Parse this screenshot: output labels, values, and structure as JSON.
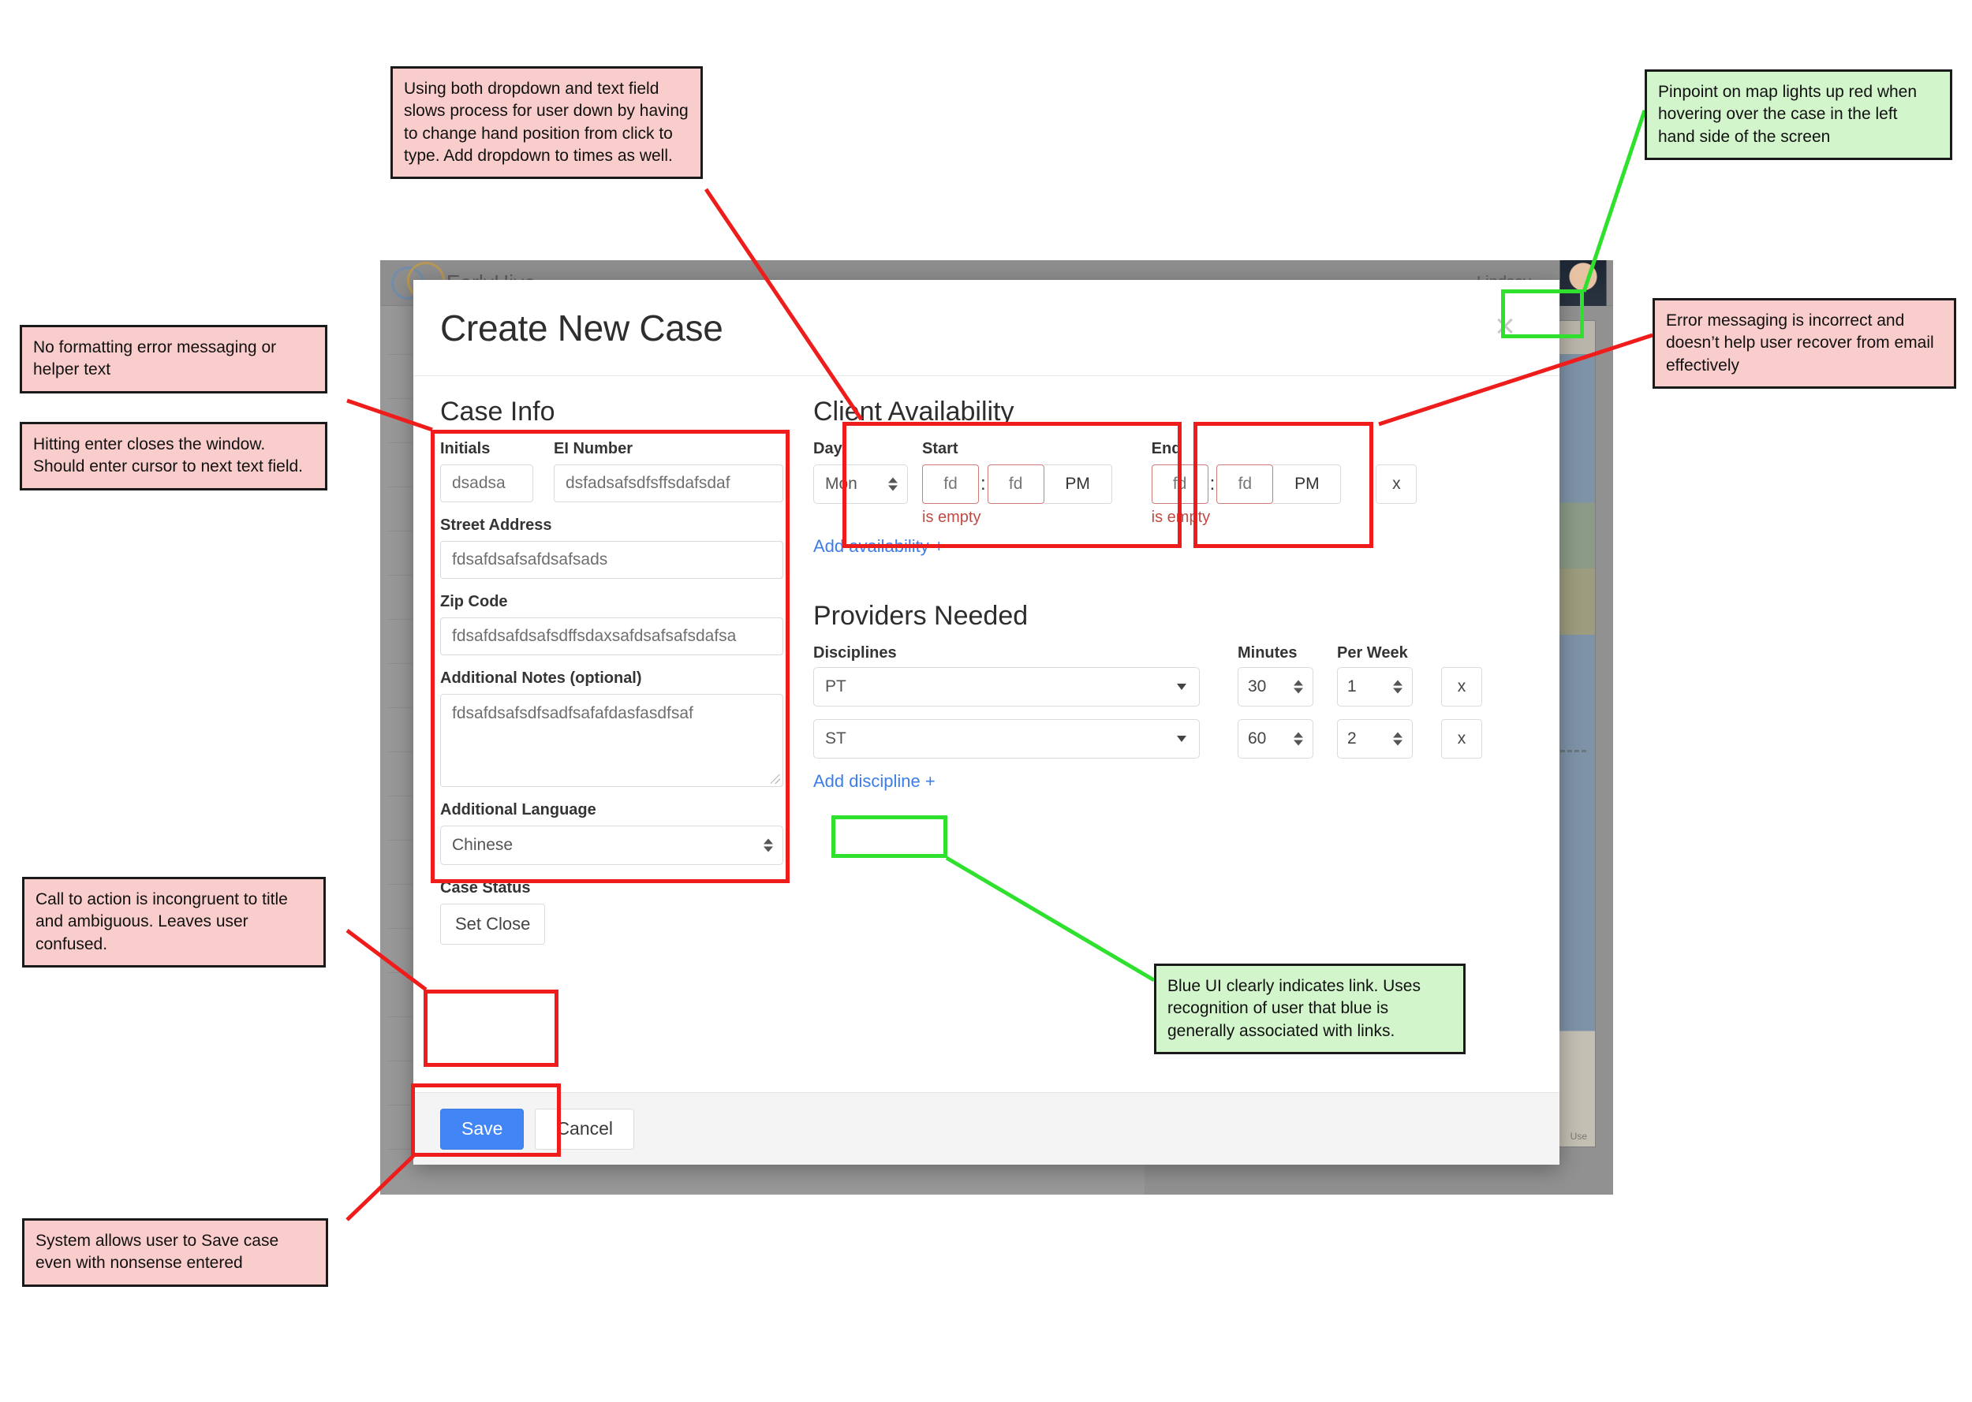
{
  "app": {
    "brand": "EarlyHive",
    "user": "Lindsey",
    "map_credit": "Use"
  },
  "modal": {
    "title": "Create New Case",
    "close_label": "×",
    "sections": {
      "case_info": "Case Info",
      "client_availability": "Client Availability",
      "providers_needed": "Providers Needed"
    },
    "case_info": {
      "initials_label": "Initials",
      "initials_value": "dsadsa",
      "ei_number_label": "EI Number",
      "ei_number_value": "dsfadsafsdfsffsdafsdaf",
      "street_label": "Street Address",
      "street_value": "fdsafdsafsafdsafsads",
      "zip_label": "Zip Code",
      "zip_value": "fdsafdsafdsafsdffsdaxsafdsafsafsdafsa",
      "notes_label": "Additional Notes (optional)",
      "notes_value": "fdsafdsafsdfsadfsafafdasfasdfsaf",
      "language_label": "Additional Language",
      "language_value": "Chinese",
      "case_status_label": "Case Status",
      "case_status_button": "Set Close"
    },
    "availability": {
      "day_label": "Day",
      "start_label": "Start",
      "end_label": "End",
      "day_value": "Mon",
      "start_hour": "fd",
      "start_minute": "fd",
      "start_meridiem": "PM",
      "start_error": "is empty",
      "end_hour": "fd",
      "end_minute": "fd",
      "end_meridiem": "PM",
      "end_error": "is empty",
      "colon": ":",
      "remove_label": "x",
      "add_link": "Add availability +"
    },
    "providers": {
      "disciplines_label": "Disciplines",
      "minutes_label": "Minutes",
      "per_week_label": "Per Week",
      "add_link": "Add discipline +",
      "rows": [
        {
          "discipline": "PT",
          "minutes": "30",
          "per_week": "1",
          "remove": "x"
        },
        {
          "discipline": "ST",
          "minutes": "60",
          "per_week": "2",
          "remove": "x"
        }
      ]
    },
    "footer": {
      "save": "Save",
      "cancel": "Cancel"
    }
  },
  "annotations": [
    {
      "id": "dropdown-text-field",
      "tone": "negative",
      "text": "Using both dropdown and text field slows process for user down by having to change hand position from click to type. Add dropdown to times as well."
    },
    {
      "id": "map-pinpoint",
      "tone": "positive",
      "text": "Pinpoint on map lights up red when hovering over the case in the left hand side of the screen"
    },
    {
      "id": "error-messaging",
      "tone": "negative",
      "text": "Error messaging is incorrect and doesn’t help user recover from email effectively"
    },
    {
      "id": "no-formatting-helper",
      "tone": "negative",
      "text": "No formatting error messaging or helper text"
    },
    {
      "id": "enter-closes-window",
      "tone": "negative",
      "text": "Hitting enter closes the window. Should enter cursor to next text field."
    },
    {
      "id": "cta-incongruent",
      "tone": "negative",
      "text": "Call to action is incongruent to title and ambiguous. Leaves user confused."
    },
    {
      "id": "blue-ui-link",
      "tone": "positive",
      "text": "Blue UI clearly indicates link. Uses recognition of user that blue is generally associated with links."
    },
    {
      "id": "save-nonsense",
      "tone": "negative",
      "text": "System allows user to Save case even with nonsense entered"
    }
  ],
  "colors": {
    "negative_note": "#f9cdcb",
    "positive_note": "#d2f5cb",
    "highlight_red": "#ef1c1c",
    "highlight_green": "#2fe02f",
    "link_blue": "#3d7de8",
    "save_blue": "#4285f4",
    "error_red": "#c04a45"
  }
}
